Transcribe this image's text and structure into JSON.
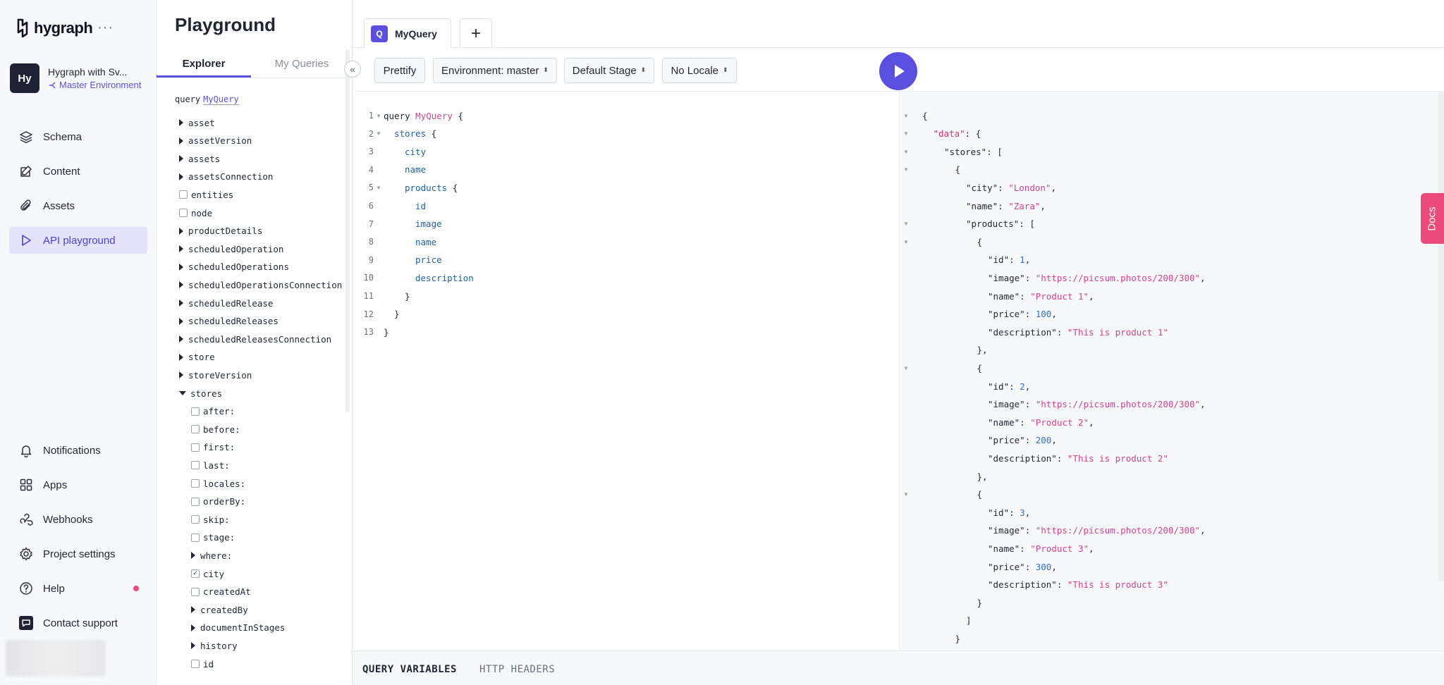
{
  "app": {
    "logo_text": "hygraph",
    "more_label": "···"
  },
  "project": {
    "initials": "Hy",
    "name": "Hygraph with Sv...",
    "environment": "Master Environment"
  },
  "nav": {
    "primary": [
      {
        "label": "Schema",
        "icon": "layers-icon"
      },
      {
        "label": "Content",
        "icon": "edit-icon"
      },
      {
        "label": "Assets",
        "icon": "paperclip-icon"
      },
      {
        "label": "API playground",
        "icon": "play-outline-icon",
        "active": true
      }
    ],
    "secondary": [
      {
        "label": "Notifications",
        "icon": "bell-icon"
      },
      {
        "label": "Apps",
        "icon": "apps-grid-icon"
      },
      {
        "label": "Webhooks",
        "icon": "webhook-icon"
      },
      {
        "label": "Project settings",
        "icon": "gear-icon"
      },
      {
        "label": "Help",
        "icon": "help-circle-icon"
      },
      {
        "label": "Contact support",
        "icon": "chat-icon"
      }
    ]
  },
  "explorer": {
    "title": "Playground",
    "tab_explorer": "Explorer",
    "tab_my_queries": "My Queries",
    "collapse_label": "«",
    "query_keyword": "query",
    "query_name": "MyQuery",
    "tree": [
      {
        "label": "asset",
        "kind": "expand",
        "indent": 0
      },
      {
        "label": "assetVersion",
        "kind": "expand",
        "indent": 0
      },
      {
        "label": "assets",
        "kind": "expand",
        "indent": 0
      },
      {
        "label": "assetsConnection",
        "kind": "expand",
        "indent": 0
      },
      {
        "label": "entities",
        "kind": "check",
        "indent": 0
      },
      {
        "label": "node",
        "kind": "check",
        "indent": 0
      },
      {
        "label": "productDetails",
        "kind": "expand",
        "indent": 0
      },
      {
        "label": "scheduledOperation",
        "kind": "expand",
        "indent": 0
      },
      {
        "label": "scheduledOperations",
        "kind": "expand",
        "indent": 0
      },
      {
        "label": "scheduledOperationsConnection",
        "kind": "expand",
        "indent": 0
      },
      {
        "label": "scheduledRelease",
        "kind": "expand",
        "indent": 0
      },
      {
        "label": "scheduledReleases",
        "kind": "expand",
        "indent": 0
      },
      {
        "label": "scheduledReleasesConnection",
        "kind": "expand",
        "indent": 0
      },
      {
        "label": "store",
        "kind": "expand",
        "indent": 0
      },
      {
        "label": "storeVersion",
        "kind": "expand",
        "indent": 0
      },
      {
        "label": "stores",
        "kind": "expanded",
        "indent": 0
      },
      {
        "label": "after:",
        "kind": "check",
        "indent": 1
      },
      {
        "label": "before:",
        "kind": "check",
        "indent": 1
      },
      {
        "label": "first:",
        "kind": "check",
        "indent": 1
      },
      {
        "label": "last:",
        "kind": "check",
        "indent": 1
      },
      {
        "label": "locales:",
        "kind": "check",
        "indent": 1
      },
      {
        "label": "orderBy:",
        "kind": "check",
        "indent": 1
      },
      {
        "label": "skip:",
        "kind": "check",
        "indent": 1
      },
      {
        "label": "stage:",
        "kind": "check",
        "indent": 1
      },
      {
        "label": "where:",
        "kind": "expand",
        "indent": 1
      },
      {
        "label": "city",
        "kind": "checked",
        "indent": 1
      },
      {
        "label": "createdAt",
        "kind": "check",
        "indent": 1
      },
      {
        "label": "createdBy",
        "kind": "expand",
        "indent": 1
      },
      {
        "label": "documentInStages",
        "kind": "expand",
        "indent": 1
      },
      {
        "label": "history",
        "kind": "expand",
        "indent": 1
      },
      {
        "label": "id",
        "kind": "check",
        "indent": 1
      }
    ]
  },
  "tabs": {
    "query_badge": "Q",
    "query_tab": "MyQuery",
    "add_tab": "+"
  },
  "toolbar": {
    "prettify": "Prettify",
    "environment": "Environment: master",
    "stage": "Default Stage",
    "locale": "No Locale",
    "sort_glyph": "⬍"
  },
  "editor": {
    "lines": [
      {
        "n": "1",
        "fold": true,
        "indent": 0,
        "parts": [
          [
            "kw",
            "query "
          ],
          [
            "qname",
            "MyQuery"
          ],
          [
            "kw",
            " {"
          ]
        ]
      },
      {
        "n": "2",
        "fold": true,
        "indent": 1,
        "parts": [
          [
            "fld",
            "stores"
          ],
          [
            "kw",
            " {"
          ]
        ]
      },
      {
        "n": "3",
        "fold": false,
        "indent": 2,
        "parts": [
          [
            "fld",
            "city"
          ]
        ]
      },
      {
        "n": "4",
        "fold": false,
        "indent": 2,
        "parts": [
          [
            "fld",
            "name"
          ]
        ]
      },
      {
        "n": "5",
        "fold": true,
        "indent": 2,
        "parts": [
          [
            "fld",
            "products"
          ],
          [
            "kw",
            " {"
          ]
        ]
      },
      {
        "n": "6",
        "fold": false,
        "indent": 3,
        "parts": [
          [
            "fld",
            "id"
          ]
        ]
      },
      {
        "n": "7",
        "fold": false,
        "indent": 3,
        "parts": [
          [
            "fld",
            "image"
          ]
        ]
      },
      {
        "n": "8",
        "fold": false,
        "indent": 3,
        "parts": [
          [
            "fld",
            "name"
          ]
        ]
      },
      {
        "n": "9",
        "fold": false,
        "indent": 3,
        "parts": [
          [
            "fld",
            "price"
          ]
        ]
      },
      {
        "n": "10",
        "fold": false,
        "indent": 3,
        "parts": [
          [
            "fld",
            "description"
          ]
        ]
      },
      {
        "n": "11",
        "fold": false,
        "indent": 2,
        "parts": [
          [
            "kw",
            "}"
          ]
        ]
      },
      {
        "n": "12",
        "fold": false,
        "indent": 1,
        "parts": [
          [
            "kw",
            "}"
          ]
        ]
      },
      {
        "n": "13",
        "fold": false,
        "indent": 0,
        "parts": [
          [
            "kw",
            "}"
          ]
        ]
      }
    ]
  },
  "result": {
    "lines": [
      {
        "fold": true,
        "indent": 0,
        "parts": [
          [
            "p",
            "{"
          ]
        ]
      },
      {
        "fold": true,
        "indent": 1,
        "parts": [
          [
            "kt",
            "\"data\""
          ],
          [
            "p",
            ": {"
          ]
        ]
      },
      {
        "fold": true,
        "indent": 2,
        "parts": [
          [
            "k",
            "\"stores\""
          ],
          [
            "p",
            ": ["
          ]
        ]
      },
      {
        "fold": true,
        "indent": 3,
        "parts": [
          [
            "p",
            "{"
          ]
        ]
      },
      {
        "fold": false,
        "indent": 4,
        "parts": [
          [
            "k",
            "\"city\""
          ],
          [
            "p",
            ": "
          ],
          [
            "s",
            "\"London\""
          ],
          [
            "p",
            ","
          ]
        ]
      },
      {
        "fold": false,
        "indent": 4,
        "parts": [
          [
            "k",
            "\"name\""
          ],
          [
            "p",
            ": "
          ],
          [
            "s",
            "\"Zara\""
          ],
          [
            "p",
            ","
          ]
        ]
      },
      {
        "fold": true,
        "indent": 4,
        "parts": [
          [
            "k",
            "\"products\""
          ],
          [
            "p",
            ": ["
          ]
        ]
      },
      {
        "fold": true,
        "indent": 5,
        "parts": [
          [
            "p",
            "{"
          ]
        ]
      },
      {
        "fold": false,
        "indent": 6,
        "parts": [
          [
            "k",
            "\"id\""
          ],
          [
            "p",
            ": "
          ],
          [
            "n",
            "1"
          ],
          [
            "p",
            ","
          ]
        ]
      },
      {
        "fold": false,
        "indent": 6,
        "parts": [
          [
            "k",
            "\"image\""
          ],
          [
            "p",
            ": "
          ],
          [
            "s",
            "\"https://picsum.photos/200/300\""
          ],
          [
            "p",
            ","
          ]
        ]
      },
      {
        "fold": false,
        "indent": 6,
        "parts": [
          [
            "k",
            "\"name\""
          ],
          [
            "p",
            ": "
          ],
          [
            "s",
            "\"Product 1\""
          ],
          [
            "p",
            ","
          ]
        ]
      },
      {
        "fold": false,
        "indent": 6,
        "parts": [
          [
            "k",
            "\"price\""
          ],
          [
            "p",
            ": "
          ],
          [
            "n",
            "100"
          ],
          [
            "p",
            ","
          ]
        ]
      },
      {
        "fold": false,
        "indent": 6,
        "parts": [
          [
            "k",
            "\"description\""
          ],
          [
            "p",
            ": "
          ],
          [
            "s",
            "\"This is product 1\""
          ]
        ]
      },
      {
        "fold": false,
        "indent": 5,
        "parts": [
          [
            "p",
            "},"
          ]
        ]
      },
      {
        "fold": true,
        "indent": 5,
        "parts": [
          [
            "p",
            "{"
          ]
        ]
      },
      {
        "fold": false,
        "indent": 6,
        "parts": [
          [
            "k",
            "\"id\""
          ],
          [
            "p",
            ": "
          ],
          [
            "n",
            "2"
          ],
          [
            "p",
            ","
          ]
        ]
      },
      {
        "fold": false,
        "indent": 6,
        "parts": [
          [
            "k",
            "\"image\""
          ],
          [
            "p",
            ": "
          ],
          [
            "s",
            "\"https://picsum.photos/200/300\""
          ],
          [
            "p",
            ","
          ]
        ]
      },
      {
        "fold": false,
        "indent": 6,
        "parts": [
          [
            "k",
            "\"name\""
          ],
          [
            "p",
            ": "
          ],
          [
            "s",
            "\"Product 2\""
          ],
          [
            "p",
            ","
          ]
        ]
      },
      {
        "fold": false,
        "indent": 6,
        "parts": [
          [
            "k",
            "\"price\""
          ],
          [
            "p",
            ": "
          ],
          [
            "n",
            "200"
          ],
          [
            "p",
            ","
          ]
        ]
      },
      {
        "fold": false,
        "indent": 6,
        "parts": [
          [
            "k",
            "\"description\""
          ],
          [
            "p",
            ": "
          ],
          [
            "s",
            "\"This is product 2\""
          ]
        ]
      },
      {
        "fold": false,
        "indent": 5,
        "parts": [
          [
            "p",
            "},"
          ]
        ]
      },
      {
        "fold": true,
        "indent": 5,
        "parts": [
          [
            "p",
            "{"
          ]
        ]
      },
      {
        "fold": false,
        "indent": 6,
        "parts": [
          [
            "k",
            "\"id\""
          ],
          [
            "p",
            ": "
          ],
          [
            "n",
            "3"
          ],
          [
            "p",
            ","
          ]
        ]
      },
      {
        "fold": false,
        "indent": 6,
        "parts": [
          [
            "k",
            "\"image\""
          ],
          [
            "p",
            ": "
          ],
          [
            "s",
            "\"https://picsum.photos/200/300\""
          ],
          [
            "p",
            ","
          ]
        ]
      },
      {
        "fold": false,
        "indent": 6,
        "parts": [
          [
            "k",
            "\"name\""
          ],
          [
            "p",
            ": "
          ],
          [
            "s",
            "\"Product 3\""
          ],
          [
            "p",
            ","
          ]
        ]
      },
      {
        "fold": false,
        "indent": 6,
        "parts": [
          [
            "k",
            "\"price\""
          ],
          [
            "p",
            ": "
          ],
          [
            "n",
            "300"
          ],
          [
            "p",
            ","
          ]
        ]
      },
      {
        "fold": false,
        "indent": 6,
        "parts": [
          [
            "k",
            "\"description\""
          ],
          [
            "p",
            ": "
          ],
          [
            "s",
            "\"This is product 3\""
          ]
        ]
      },
      {
        "fold": false,
        "indent": 5,
        "parts": [
          [
            "p",
            "}"
          ]
        ]
      },
      {
        "fold": false,
        "indent": 4,
        "parts": [
          [
            "p",
            "]"
          ]
        ]
      },
      {
        "fold": false,
        "indent": 3,
        "parts": [
          [
            "p",
            "}"
          ]
        ]
      }
    ]
  },
  "docs_label": "Docs",
  "bottom": {
    "query_variables": "QUERY VARIABLES",
    "http_headers": "HTTP HEADERS"
  },
  "colors": {
    "accent": "#5b4fe0",
    "docs": "#ec4a7a",
    "string": "#d64292",
    "number": "#2e6fd6"
  }
}
